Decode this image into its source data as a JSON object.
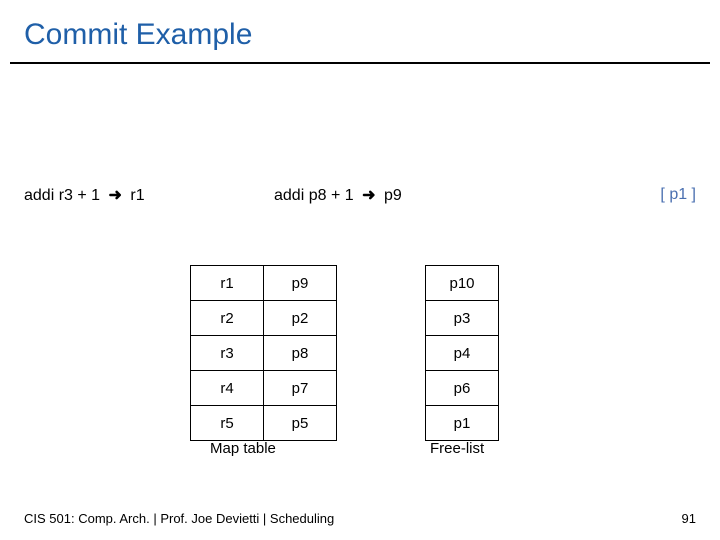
{
  "title": "Commit Example",
  "instruction": {
    "before_op": "addi r3 + 1",
    "before_dest": "r1",
    "after_op": "addi p8 + 1",
    "after_dest": "p9",
    "bracket_reg": "[ p1 ]"
  },
  "map_table": {
    "label": "Map table",
    "rows": [
      {
        "reg": "r1",
        "phys": "p9"
      },
      {
        "reg": "r2",
        "phys": "p2"
      },
      {
        "reg": "r3",
        "phys": "p8"
      },
      {
        "reg": "r4",
        "phys": "p7"
      },
      {
        "reg": "r5",
        "phys": "p5"
      }
    ]
  },
  "free_list": {
    "label": "Free-list",
    "entries": [
      "p10",
      "p3",
      "p4",
      "p6",
      "p1"
    ]
  },
  "footer": {
    "left": "CIS 501: Comp. Arch. | Prof. Joe Devietti | Scheduling",
    "right": "91"
  },
  "icons": {
    "arrow": "➜"
  }
}
